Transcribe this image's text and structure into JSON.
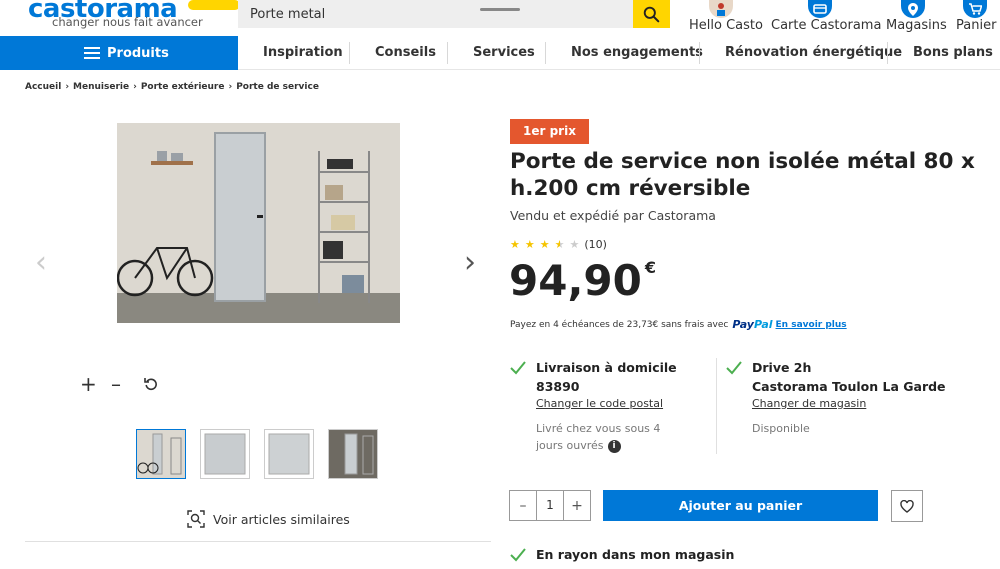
{
  "header": {
    "logo_text": "castorama",
    "tagline": "changer nous fait avancer",
    "search": {
      "value": "Porte metal",
      "placeholder": ""
    },
    "links": [
      {
        "label": "Hello Casto",
        "icon": "user-avatar-icon"
      },
      {
        "label": "Carte Castorama",
        "icon": "card-icon"
      },
      {
        "label": "Magasins",
        "icon": "map-pin-icon"
      },
      {
        "label": "Panier",
        "icon": "cart-icon"
      }
    ]
  },
  "nav": {
    "products_label": "Produits",
    "items": [
      "Inspiration",
      "Conseils",
      "Services",
      "Nos engagements",
      "Rénovation énergétique",
      "Bons plans"
    ]
  },
  "breadcrumb": [
    "Accueil",
    "Menuiserie",
    "Porte extérieure",
    "Porte de service"
  ],
  "gallery": {
    "similar_label": "Voir articles similaires"
  },
  "product": {
    "badge": "1er prix",
    "title": "Porte de service non isolée métal 80 x h.200 cm réversible",
    "seller": "Vendu et expédié par Castorama",
    "rating": {
      "value": 3.5,
      "max": 5,
      "count_label": "(10)"
    },
    "price": "94,90",
    "currency": "€",
    "paypal": {
      "text": "Payez en 4 échéances de 23,73€ sans frais avec",
      "brand_pay": "Pay",
      "brand_pal": "Pal",
      "link": "En savoir plus"
    }
  },
  "delivery": {
    "home": {
      "title": "Livraison à domicile",
      "postal_code": "83890",
      "link": "Changer le code postal",
      "note": "Livré chez vous sous 4 jours ouvrés"
    },
    "drive": {
      "title": "Drive 2h",
      "store": "Castorama Toulon La Garde",
      "link": "Changer de magasin",
      "status": "Disponible"
    },
    "in_store": "En rayon dans mon magasin"
  },
  "cart": {
    "quantity": "1",
    "add_label": "Ajouter au panier"
  },
  "colors": {
    "brand_blue": "#0078d7",
    "brand_yellow": "#ffd500",
    "badge_orange": "#e4572e",
    "check_green": "#4caf50",
    "star_yellow": "#f5c400"
  }
}
